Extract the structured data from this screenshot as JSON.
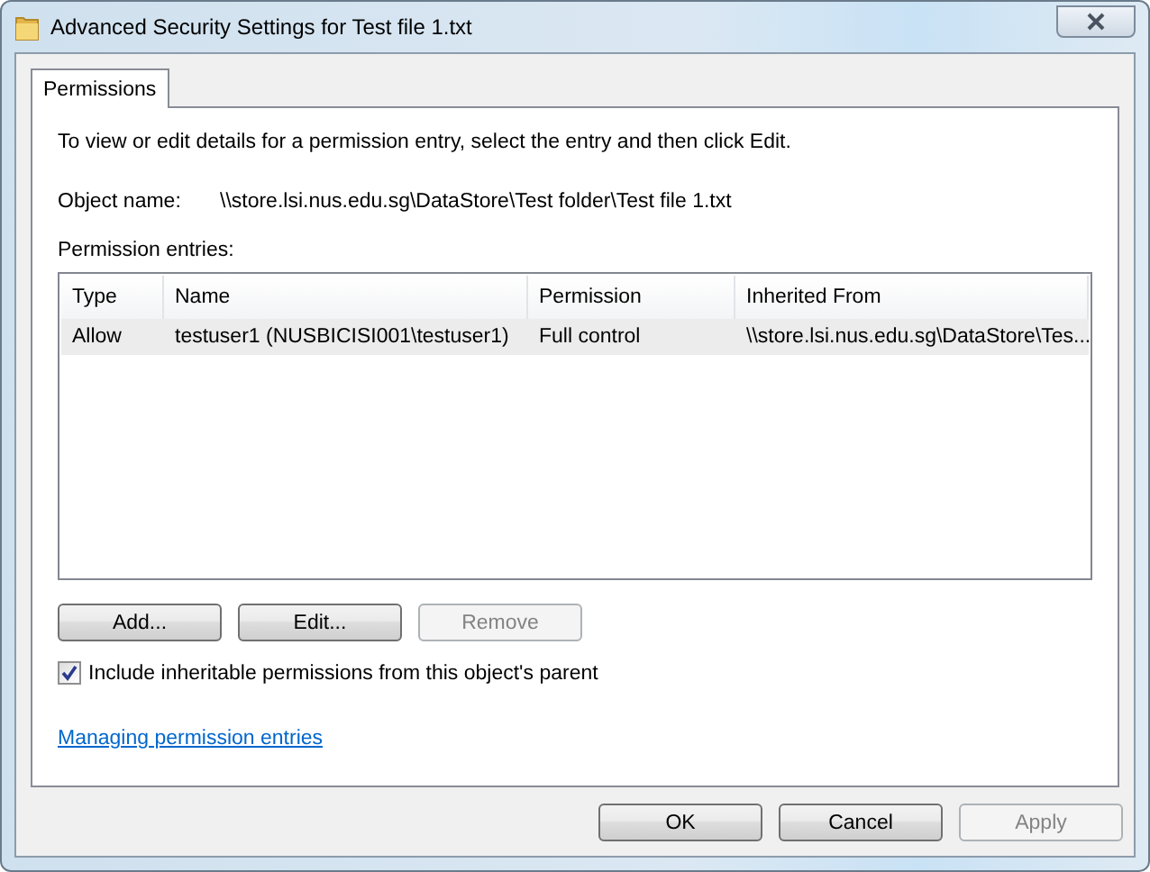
{
  "window": {
    "title": "Advanced Security Settings for Test file 1.txt"
  },
  "tabs": [
    {
      "label": "Permissions",
      "selected": true
    }
  ],
  "instructions": "To view or edit details for a permission entry, select the entry and then click Edit.",
  "object_name": {
    "label": "Object name:",
    "value": "\\\\store.lsi.nus.edu.sg\\DataStore\\Test folder\\Test file 1.txt"
  },
  "entries_label": "Permission entries:",
  "table": {
    "columns": [
      "Type",
      "Name",
      "Permission",
      "Inherited From"
    ],
    "rows": [
      {
        "cells": [
          "Allow",
          "testuser1 (NUSBICISI001\\testuser1)",
          "Full control",
          "\\\\store.lsi.nus.edu.sg\\DataStore\\Tes..."
        ],
        "selected": true
      }
    ]
  },
  "entry_buttons": [
    {
      "label": "Add...",
      "disabled": false
    },
    {
      "label": "Edit...",
      "disabled": false
    },
    {
      "label": "Remove",
      "disabled": true
    }
  ],
  "inherit_checkbox": {
    "label": "Include inheritable permissions from this object's parent",
    "checked": true
  },
  "help_link": "Managing permission entries",
  "footer_buttons": [
    {
      "label": "OK",
      "disabled": false
    },
    {
      "label": "Cancel",
      "disabled": false
    },
    {
      "label": "Apply",
      "disabled": true
    }
  ]
}
